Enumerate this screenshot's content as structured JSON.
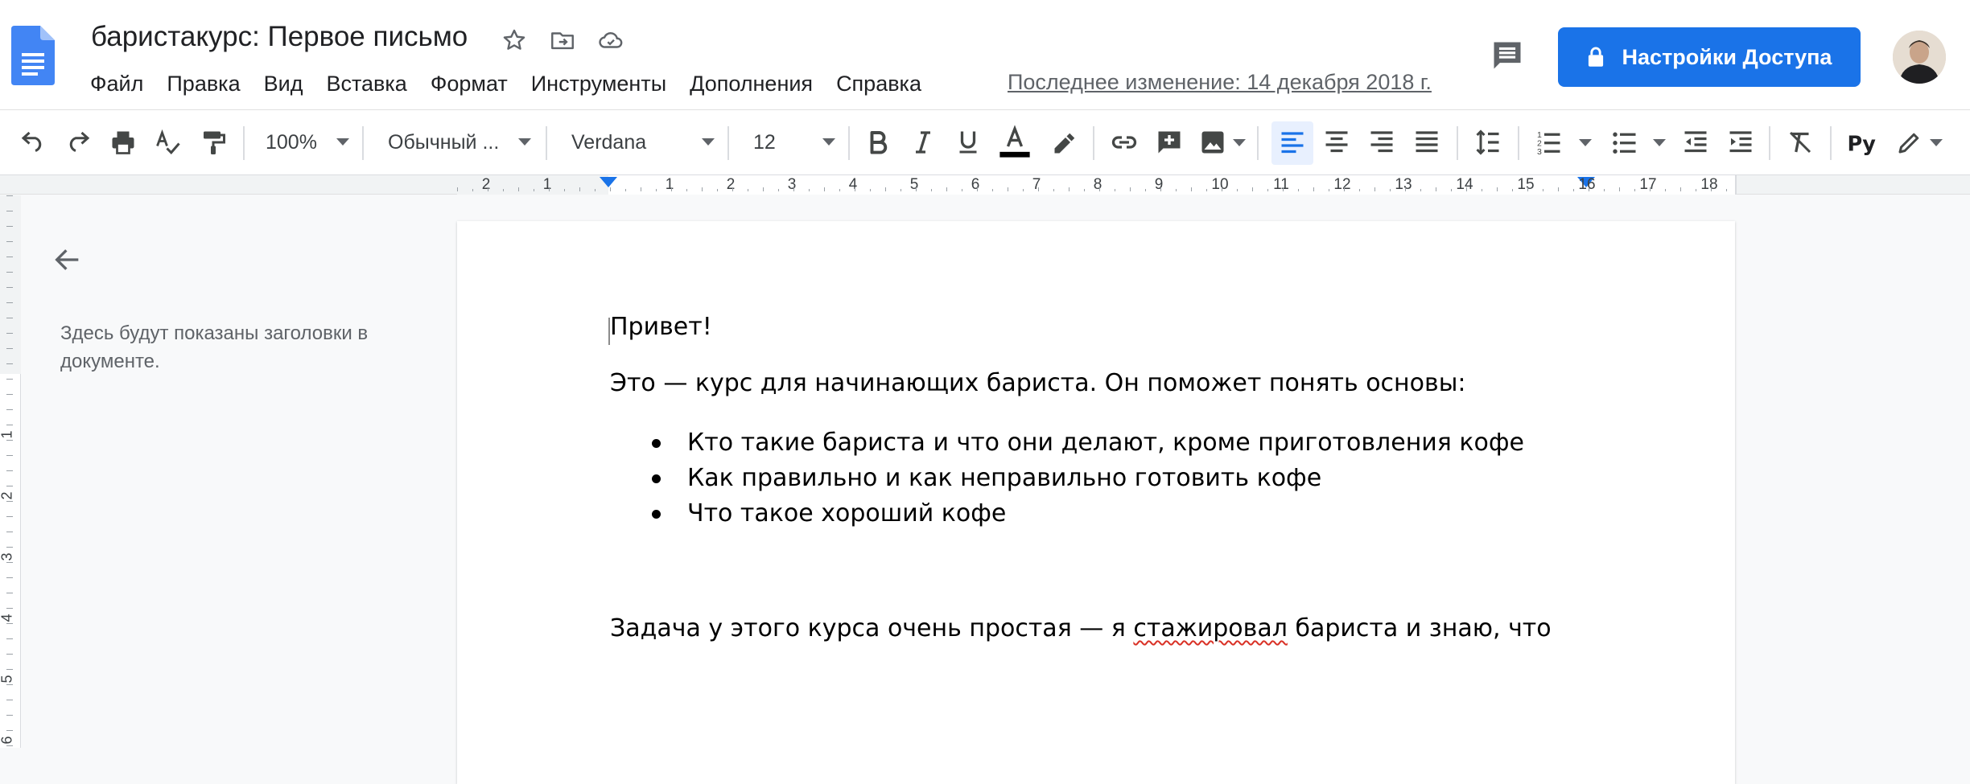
{
  "document": {
    "title": "баристакурс: Первое письмо",
    "last_edit": "Последнее изменение: 14 декабря 2018 г."
  },
  "menu": {
    "items": [
      "Файл",
      "Правка",
      "Вид",
      "Вставка",
      "Формат",
      "Инструменты",
      "Дополнения",
      "Справка"
    ]
  },
  "share": {
    "label": "Настройки Доступа"
  },
  "toolbar": {
    "zoom": "100%",
    "style": "Обычный ...",
    "font": "Verdana",
    "font_size": "12",
    "text_color": "#000000",
    "accent": "#1a73e8",
    "active_alignment": "left",
    "icons": [
      "undo-icon",
      "redo-icon",
      "print-icon",
      "spellcheck-icon",
      "paint-format-icon",
      "bold-icon",
      "italic-icon",
      "underline-icon",
      "text-color-icon",
      "highlight-icon",
      "link-icon",
      "insert-comment-icon",
      "insert-image-icon",
      "align-left-icon",
      "align-center-icon",
      "align-right-icon",
      "align-justify-icon",
      "line-spacing-icon",
      "numbered-list-icon",
      "bulleted-list-icon",
      "decrease-indent-icon",
      "increase-indent-icon",
      "clear-formatting-icon",
      "input-tools-icon",
      "editing-mode-icon"
    ]
  },
  "ruler": {
    "labels": [
      "2",
      "1",
      "1",
      "2",
      "3",
      "4",
      "5",
      "6",
      "7",
      "8",
      "9",
      "10",
      "11",
      "12",
      "13",
      "14",
      "15",
      "16",
      "17",
      "18"
    ],
    "vertical_labels": [
      "1",
      "2",
      "3",
      "4",
      "5",
      "6"
    ]
  },
  "outline": {
    "placeholder": "Здесь будут показаны заголовки в документе."
  },
  "content": {
    "greeting": "Привет!",
    "intro": "Это — курс для начинающих бариста. Он поможет понять основы:",
    "bullets": [
      "Кто такие бариста и что они делают, кроме приготовления кофе",
      "Как правильно и как неправильно готовить кофе",
      "Что такое хороший кофе"
    ],
    "task_before": "Задача у этого курса очень простая — я ",
    "task_misspelled": "стажировал",
    "task_after": " бариста и знаю, что"
  }
}
